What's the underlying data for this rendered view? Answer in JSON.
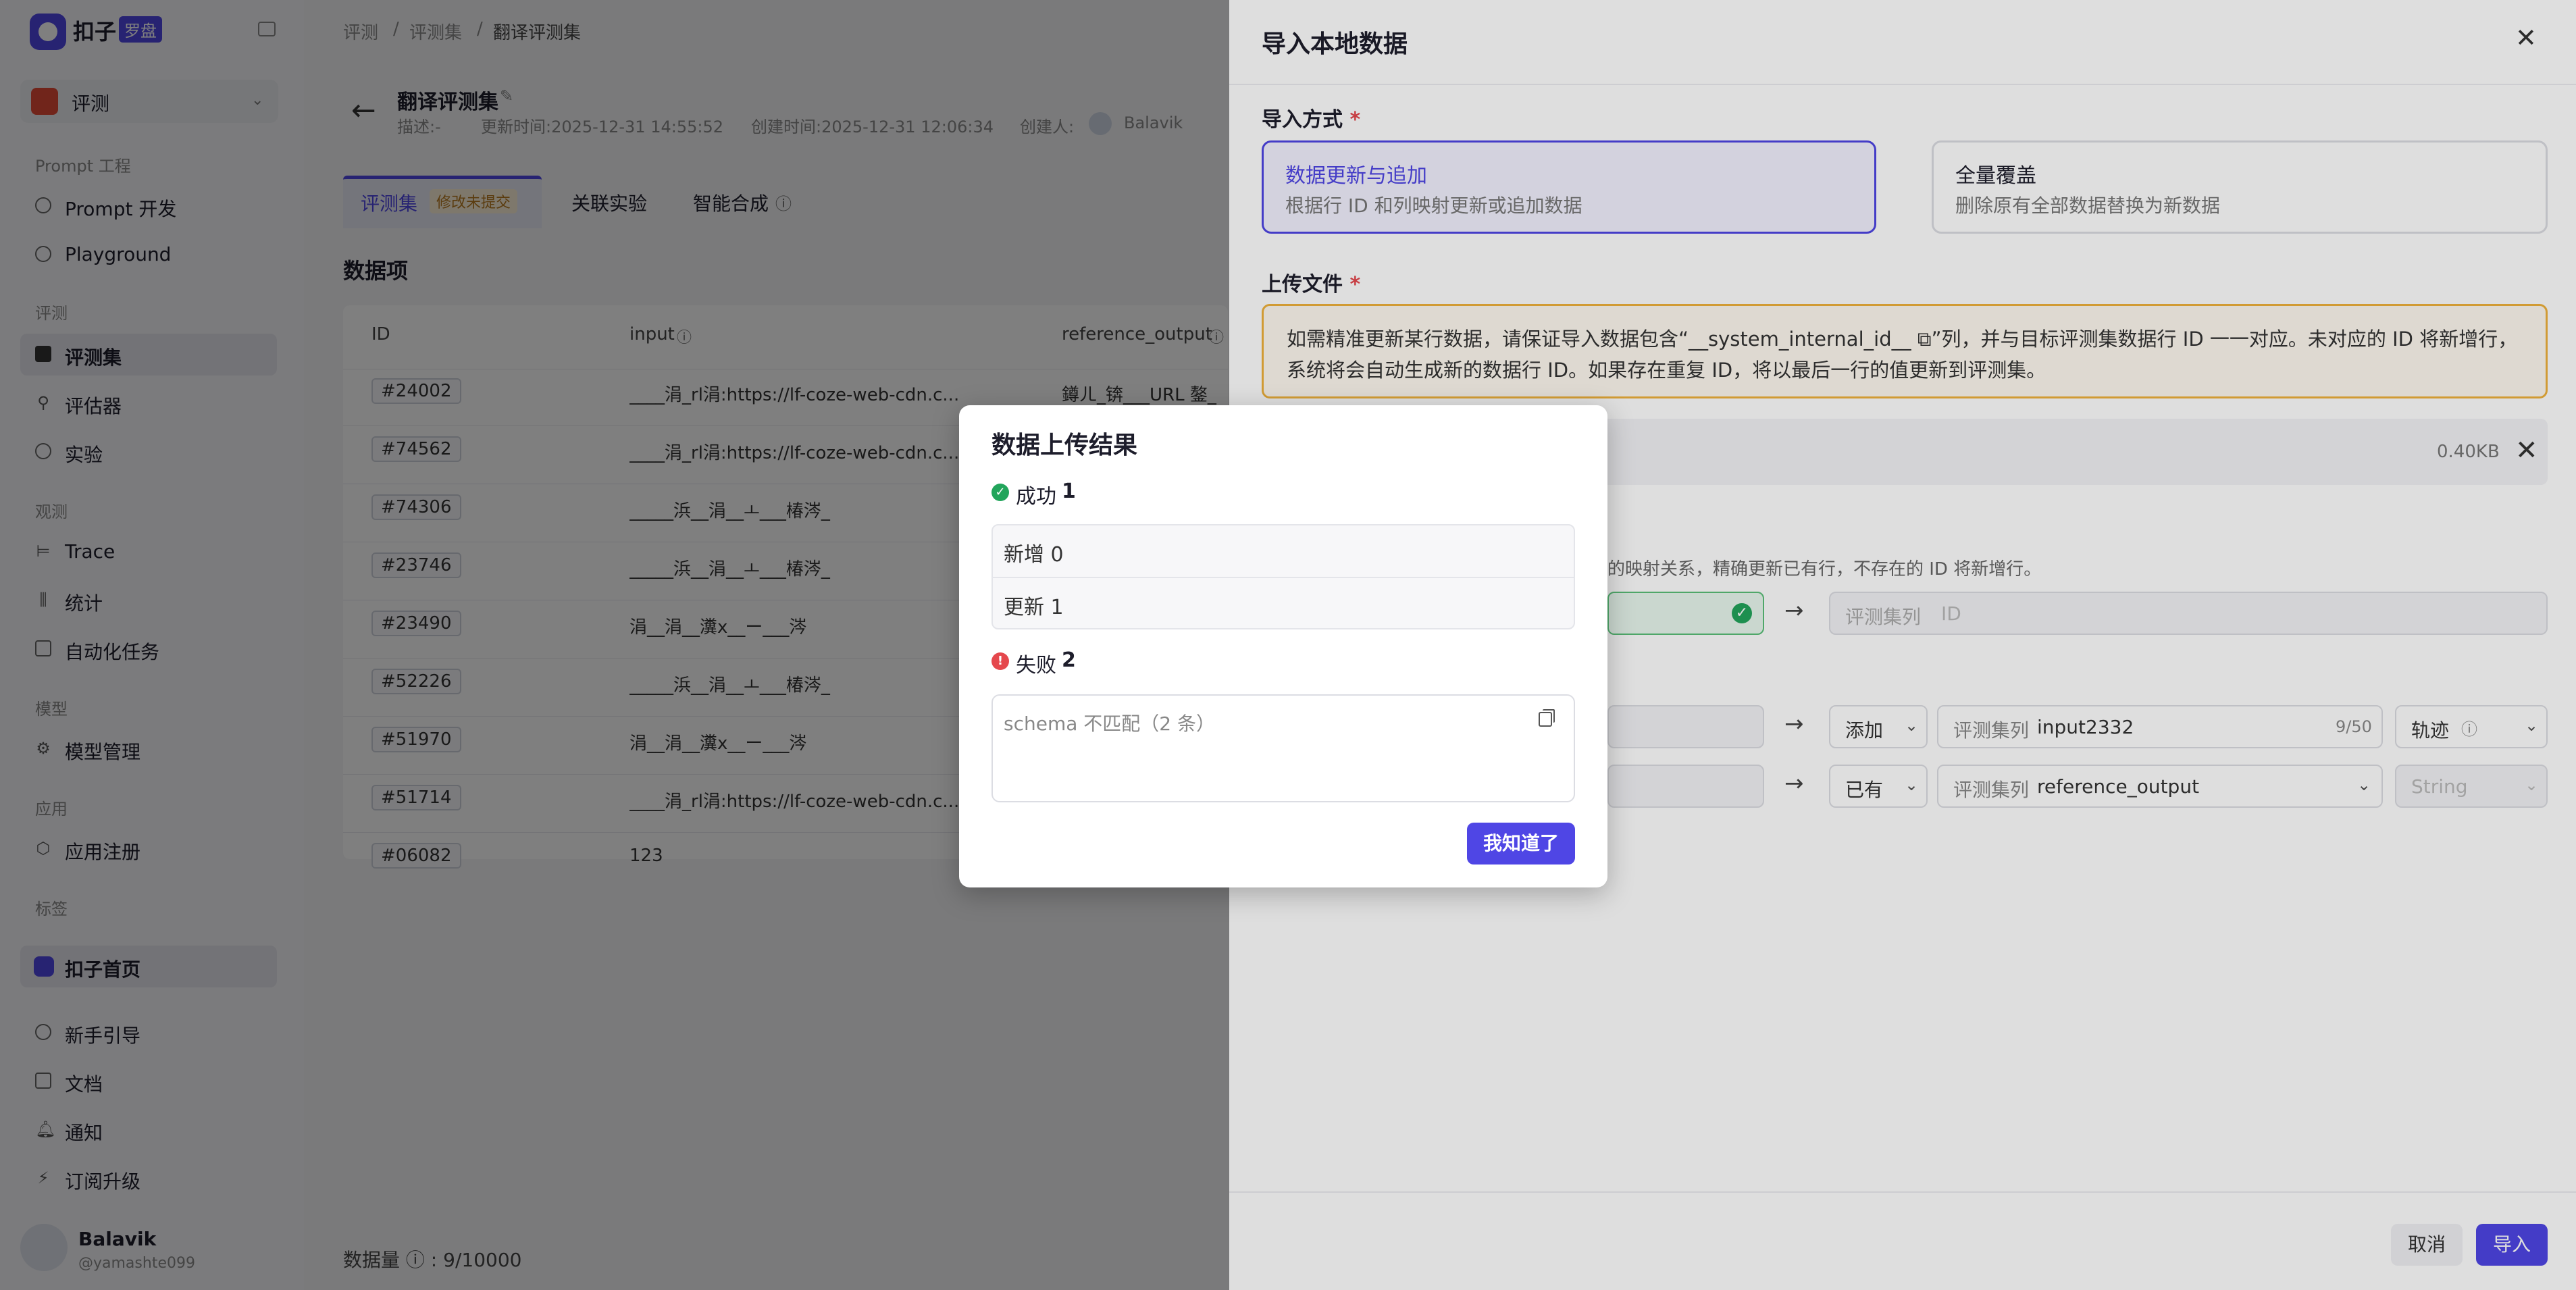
{
  "sidebar": {
    "brand": "扣子",
    "brand_tag": "罗盘",
    "workspace": "评测",
    "sections": {
      "prompt": "Prompt 工程",
      "eval": "评测",
      "observe": "观测",
      "model": "模型",
      "app": "应用",
      "tag": "标签"
    },
    "items": {
      "prompt_dev": "Prompt 开发",
      "playground": "Playground",
      "datasets": "评测集",
      "evaluators": "评估器",
      "experiments": "实验",
      "trace": "Trace",
      "stats": "统计",
      "automation": "自动化任务",
      "model_mgmt": "模型管理",
      "app_reg": "应用注册",
      "home": "扣子首页",
      "guide": "新手引导",
      "docs": "文档",
      "notify": "通知",
      "upgrade": "订阅升级"
    },
    "user": {
      "name": "Balavik",
      "handle": "@yamashte099"
    }
  },
  "breadcrumb": [
    "评测",
    "评测集",
    "翻译评测集"
  ],
  "dataset": {
    "name": "翻译评测集",
    "desc": "描述:-",
    "updated": "更新时间:2025-12-31 14:55:52",
    "created": "创建时间:2025-12-31 12:06:34",
    "creator_label": "创建人:",
    "creator": "Balavik"
  },
  "tabs": {
    "dataset": "评测集",
    "pending": "修改未提交",
    "experiments": "关联实验",
    "synth": "智能合成"
  },
  "items_heading": "数据项",
  "table": {
    "cols": [
      "ID",
      "input",
      "reference_output"
    ],
    "rows": [
      {
        "id": "#24002",
        "input": "____涓_rl涓:https://lf-coze-web-cdn.c...",
        "ref": "鐏ㄦ_锛___URL 鏊_"
      },
      {
        "id": "#74562",
        "input": "____涓_rl涓:https://lf-coze-web-cdn.c...",
        "ref": ""
      },
      {
        "id": "#74306",
        "input": "_____浜__涓__ㅗ___椿涔_",
        "ref": ""
      },
      {
        "id": "#23746",
        "input": "_____浜__涓__ㅗ___椿涔_",
        "ref": ""
      },
      {
        "id": "#23490",
        "input": "涓__涓__瀵x__ー___涔",
        "ref": ""
      },
      {
        "id": "#52226",
        "input": "_____浜__涓__ㅗ___椿涔_",
        "ref": ""
      },
      {
        "id": "#51970",
        "input": "涓__涓__瀵x__ー___涔",
        "ref": ""
      },
      {
        "id": "#51714",
        "input": "____涓_rl涓:https://lf-coze-web-cdn.c...",
        "ref": ""
      },
      {
        "id": "#06082",
        "input": "123",
        "ref": ""
      }
    ]
  },
  "count": "数据量 ⓘ : 9/10000",
  "drawer": {
    "title": "导入本地数据",
    "import_mode_label": "导入方式",
    "opt_append_title": "数据更新与追加",
    "opt_append_desc": "根据行 ID 和列映射更新或追加数据",
    "opt_overwrite_title": "全量覆盖",
    "opt_overwrite_desc": "删除原有全部数据替换为新数据",
    "upload_label": "上传文件",
    "warning": "如需精准更新某行数据，请保证导入数据包含“__system_internal_id__ ⧉”列，并与目标评测集数据行 ID 一一对应。未对应的 ID 将新增行，系统将会自动生成新的数据行 ID。如果存在重复 ID，将以最后一行的值更新到评测集。",
    "file_size": "0.40KB",
    "mapping_desc": "的映射关系，精确更新已有行，不存在的 ID 将新增行。",
    "id_target_label": "评测集列",
    "id_target_placeholder": "ID",
    "row1_action": "添加",
    "row1_label": "评测集列",
    "row1_value": "input2332",
    "row1_count": "9/50",
    "row1_type": "轨迹",
    "row2_action": "已有",
    "row2_label": "评测集列",
    "row2_value": "reference_output",
    "row2_type": "String",
    "cancel": "取消",
    "import": "导入"
  },
  "modal": {
    "title": "数据上传结果",
    "success_label": "成功",
    "success_count": "1",
    "added": "新增 0",
    "updated": "更新 1",
    "fail_label": "失败",
    "fail_count": "2",
    "fail_detail": "schema 不匹配（2 条）",
    "confirm": "我知道了"
  }
}
